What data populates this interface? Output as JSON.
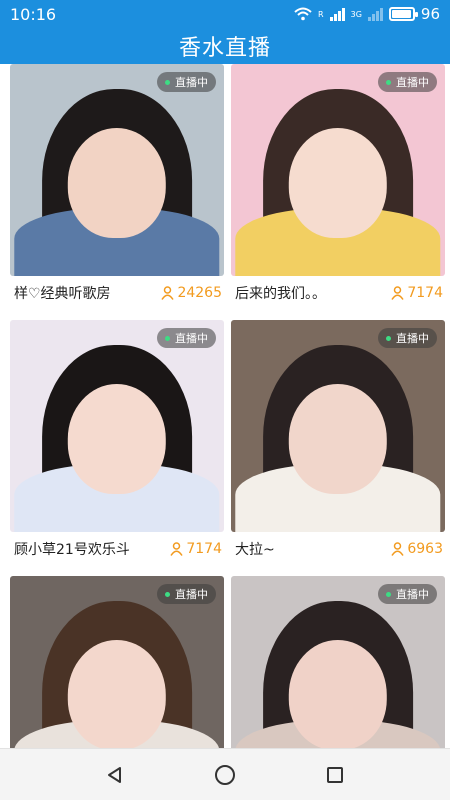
{
  "status_bar": {
    "time": "10:16",
    "battery_level": "96",
    "network_label": "3G"
  },
  "header": {
    "title": "香水直播"
  },
  "rooms": [
    {
      "name": "样♡经典听歌房",
      "viewers": "24265",
      "live_label": "直播中",
      "bg": "#b9c4cc",
      "hair": "#1e1a1a",
      "skin": "#f2d3c4",
      "outfit": "#5a7aa6"
    },
    {
      "name": "后来的我们。。",
      "viewers": "7174",
      "live_label": "直播中",
      "bg": "#f3c6d3",
      "hair": "#3a2a26",
      "skin": "#f6dccf",
      "outfit": "#f2cf62"
    },
    {
      "name": "顾小草21号欢乐斗",
      "viewers": "7174",
      "live_label": "直播中",
      "bg": "#ece6ef",
      "hair": "#1a1616",
      "skin": "#f5dacf",
      "outfit": "#dfe6f5"
    },
    {
      "name": "大拉~",
      "viewers": "6963",
      "live_label": "直播中",
      "bg": "#7b6a5e",
      "hair": "#2a2222",
      "skin": "#f1d6cb",
      "outfit": "#f3efe9"
    },
    {
      "name": "",
      "viewers": "",
      "live_label": "直播中",
      "bg": "#6f6661",
      "hair": "#4a3326",
      "skin": "#f3d7cc",
      "outfit": "#e9e2dc"
    },
    {
      "name": "",
      "viewers": "",
      "live_label": "直播中",
      "bg": "#c9c4c4",
      "hair": "#2a2222",
      "skin": "#f0d2c8",
      "outfit": "#d9c8c0"
    }
  ],
  "nav": {
    "back": "back",
    "home": "home",
    "recents": "recents"
  }
}
